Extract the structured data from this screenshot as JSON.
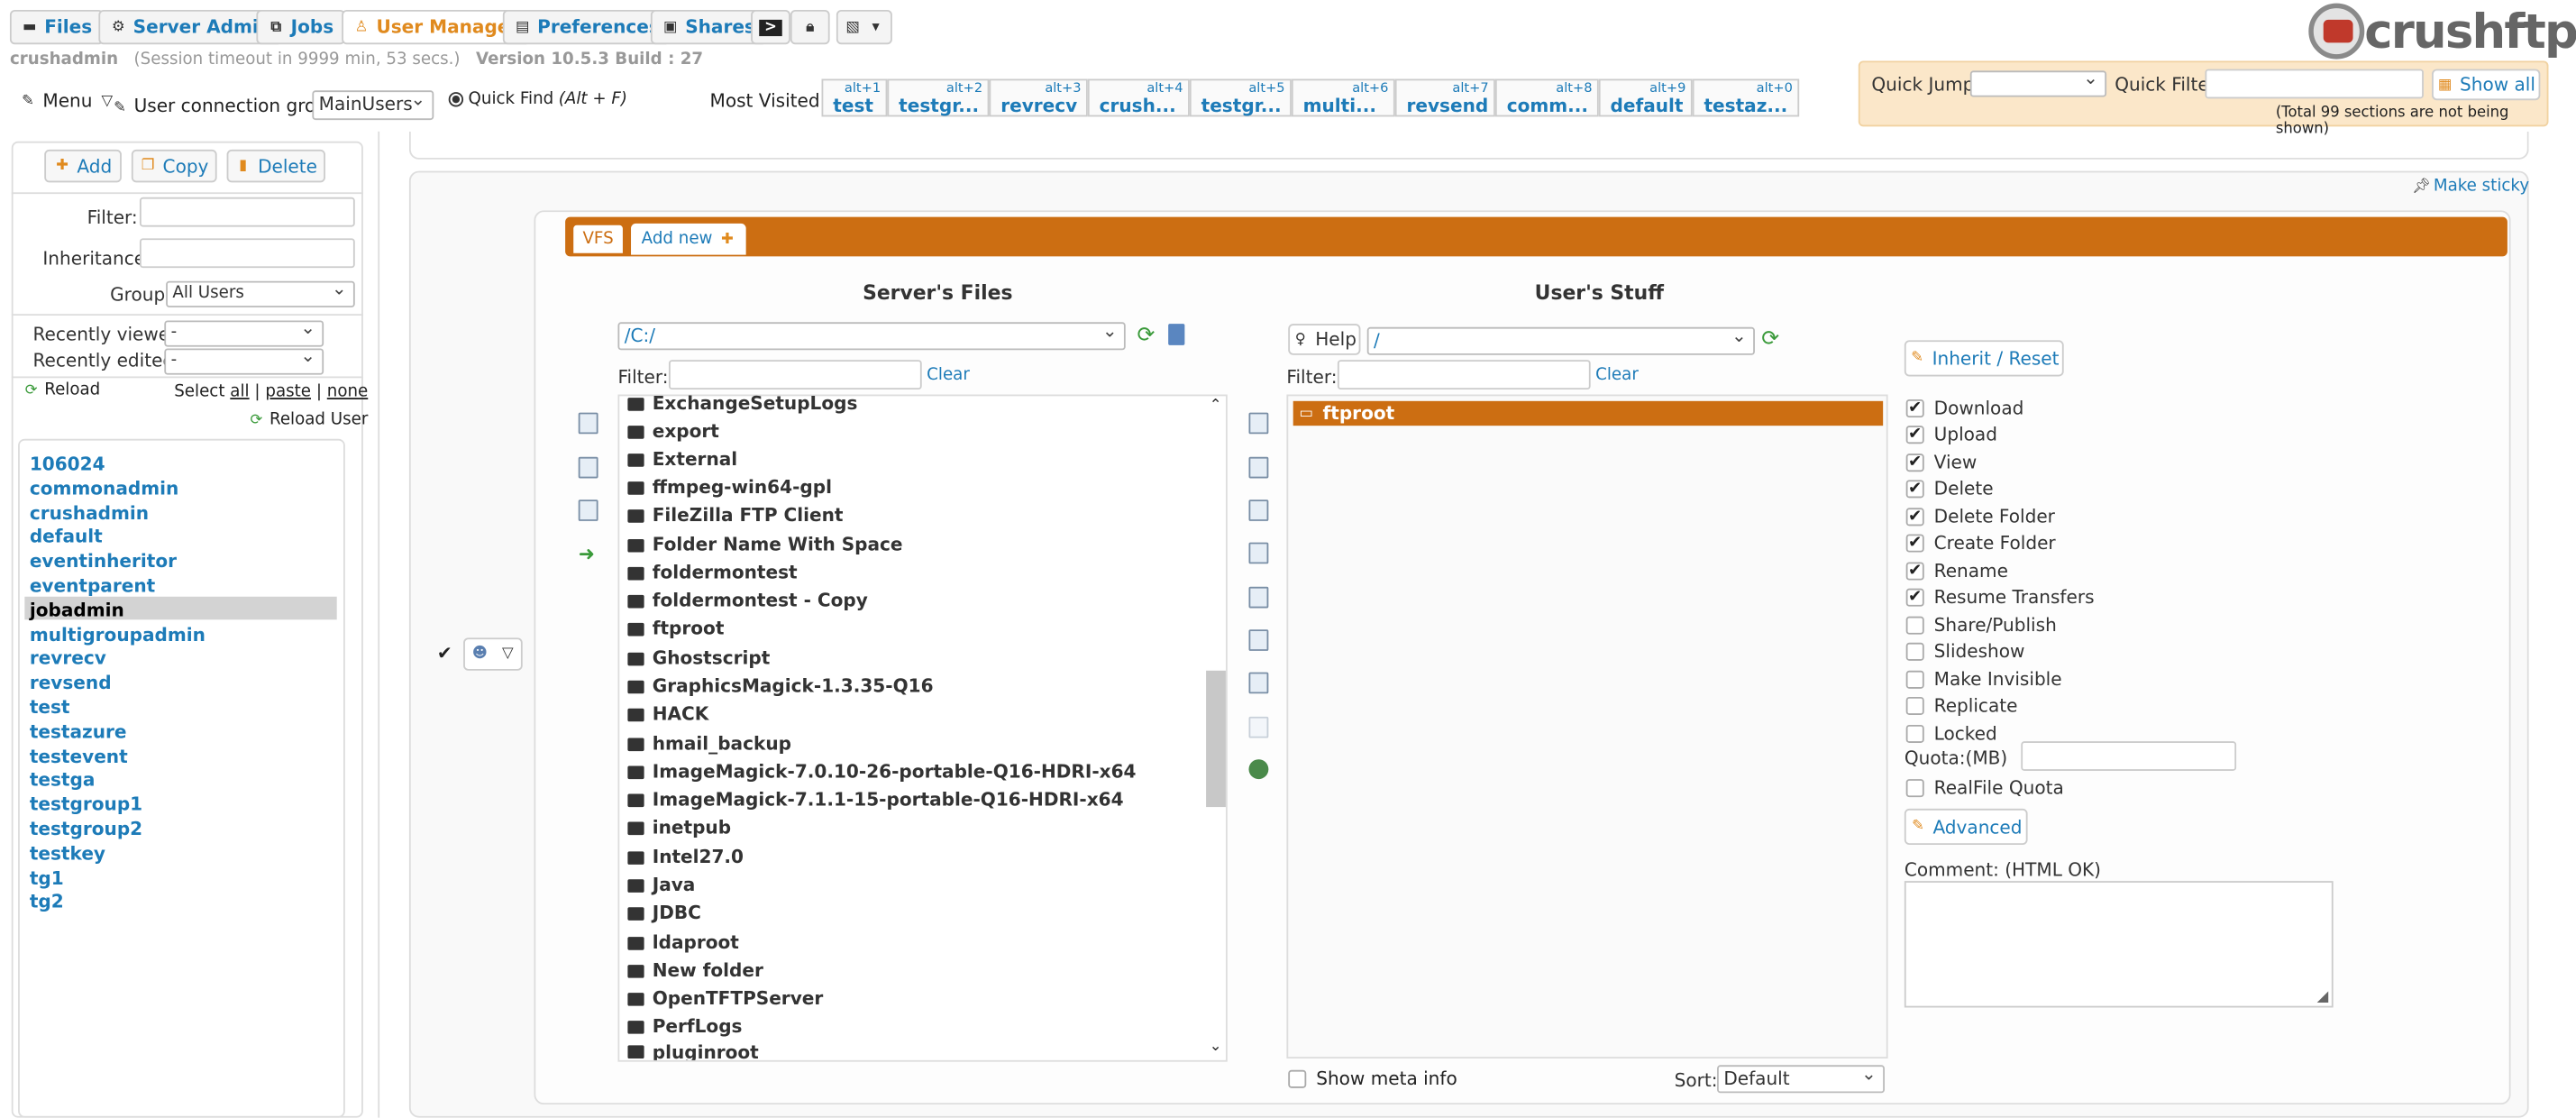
{
  "nav": {
    "tabs": [
      "Files",
      "Server Admin",
      "Jobs",
      "User Manager",
      "Preferences",
      "Shares"
    ]
  },
  "brand": {
    "logo": "crushftp"
  },
  "session": {
    "user": "crushadmin",
    "timeout": "(Session timeout in 9999 min, 53 secs.)",
    "version": "Version 10.5.3 Build : 27"
  },
  "toolbar": {
    "menu": "Menu",
    "connection_group_label": "User connection group:",
    "connection_group": "MainUsers",
    "quick_find": "Quick Find",
    "quick_find_key": "(Alt + F)",
    "most_visited_label": "Most Visited :"
  },
  "most_visited": [
    {
      "k": "alt+1",
      "t": "test"
    },
    {
      "k": "alt+2",
      "t": "testgr..."
    },
    {
      "k": "alt+3",
      "t": "revrecv"
    },
    {
      "k": "alt+4",
      "t": "crush..."
    },
    {
      "k": "alt+5",
      "t": "testgr..."
    },
    {
      "k": "alt+6",
      "t": "multi..."
    },
    {
      "k": "alt+7",
      "t": "revsend"
    },
    {
      "k": "alt+8",
      "t": "comm..."
    },
    {
      "k": "alt+9",
      "t": "default"
    },
    {
      "k": "alt+0",
      "t": "testaz..."
    }
  ],
  "quick": {
    "jump": "Quick Jump:",
    "filter": "Quick Filter",
    "show_all": "Show all",
    "note": "(Total 99 sections are not being shown)"
  },
  "left": {
    "add": "Add",
    "copy": "Copy",
    "delete": "Delete",
    "filter": "Filter:",
    "inheritance": "Inheritance:",
    "group": "Group:",
    "group_val": "All Users",
    "recent_viewed": "Recently viewed:",
    "recent_edited": "Recently edited:",
    "dash": "-",
    "reload": "Reload",
    "select": "Select",
    "all": "all",
    "paste": "paste",
    "none": "none",
    "sep": "|",
    "reload_user": "Reload User"
  },
  "users": [
    "106024",
    "commonadmin",
    "crushadmin",
    "default",
    "eventinheritor",
    "eventparent",
    "jobadmin",
    "multigroupadmin",
    "revrecv",
    "revsend",
    "test",
    "testazure",
    "testevent",
    "testga",
    "testgroup1",
    "testgroup2",
    "testkey",
    "tg1",
    "tg2"
  ],
  "main": {
    "make_sticky": "Make sticky",
    "vfs": "VFS",
    "add_new": "Add new",
    "server_files": "Server's Files",
    "users_stuff": "User's Stuff",
    "path": "/C:/",
    "filter": "Filter:",
    "clear": "Clear",
    "help": "Help",
    "user_path": "/",
    "ftproot": "ftproot",
    "show_meta": "Show meta info",
    "sort": "Sort:",
    "sort_val": "Default"
  },
  "files": [
    "ExchangeSetupLogs",
    "export",
    "External",
    "ffmpeg-win64-gpl",
    "FileZilla FTP Client",
    "Folder Name With Space",
    "foldermontest",
    "foldermontest - Copy",
    "ftproot",
    "Ghostscript",
    "GraphicsMagick-1.3.35-Q16",
    "HACK",
    "hmail_backup",
    "ImageMagick-7.0.10-26-portable-Q16-HDRI-x64",
    "ImageMagick-7.1.1-15-portable-Q16-HDRI-x64",
    "inetpub",
    "Intel27.0",
    "Java",
    "JDBC",
    "ldaproot",
    "New folder",
    "OpenTFTPServer",
    "PerfLogs",
    "pluginroot"
  ],
  "perms": {
    "inherit": "Inherit / Reset",
    "items": [
      {
        "l": "Download",
        "c": true
      },
      {
        "l": "Upload",
        "c": true
      },
      {
        "l": "View",
        "c": true
      },
      {
        "l": "Delete",
        "c": true
      },
      {
        "l": "Delete Folder",
        "c": true
      },
      {
        "l": "Create Folder",
        "c": true
      },
      {
        "l": "Rename",
        "c": true
      },
      {
        "l": "Resume Transfers",
        "c": true
      },
      {
        "l": "Share/Publish",
        "c": false
      },
      {
        "l": "Slideshow",
        "c": false
      },
      {
        "l": "Make Invisible",
        "c": false
      },
      {
        "l": "Replicate",
        "c": false
      },
      {
        "l": "Locked",
        "c": false
      }
    ],
    "quota": "Quota:(MB)",
    "realfile": "RealFile Quota",
    "advanced": "Advanced",
    "comment": "Comment: (HTML OK)"
  },
  "colors": {
    "accent": "#cc6e12",
    "link": "#1d7bb8"
  }
}
